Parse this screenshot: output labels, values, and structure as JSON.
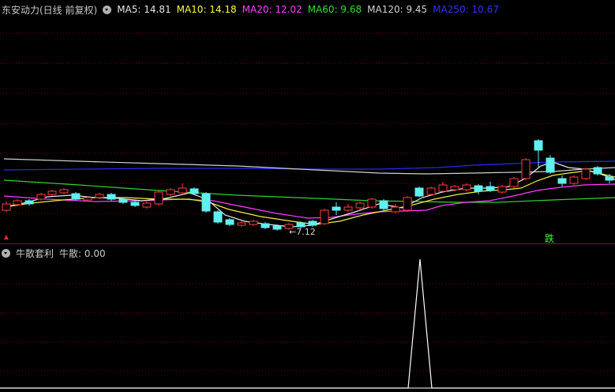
{
  "header": {
    "title": "东安动力(日线 前复权)",
    "ma": [
      {
        "label": "MA5: 14.81",
        "color": "#e6e6e6"
      },
      {
        "label": "MA10: 14.18",
        "color": "#ffff40"
      },
      {
        "label": "MA20: 12.02",
        "color": "#ff40ff"
      },
      {
        "label": "MA60: 9.68",
        "color": "#30e030"
      },
      {
        "label": "MA120: 9.45",
        "color": "#d0d0d0"
      },
      {
        "label": "MA250: 10.67",
        "color": "#3030ff"
      }
    ]
  },
  "annotations": {
    "low_price": "←7.12",
    "left_marker": "涨",
    "fall_marker": "跌"
  },
  "indicator": {
    "title": "牛散套利",
    "value_label": "牛散: 0.00"
  },
  "chart_data": {
    "type": "candlestick",
    "series": [
      {
        "name": "MA5"
      },
      {
        "name": "MA10"
      },
      {
        "name": "MA20"
      },
      {
        "name": "MA60"
      },
      {
        "name": "MA120"
      },
      {
        "name": "MA250"
      }
    ],
    "low_annotation": 7.12,
    "indicator_series": {
      "name": "牛散",
      "current": 0.0
    }
  }
}
